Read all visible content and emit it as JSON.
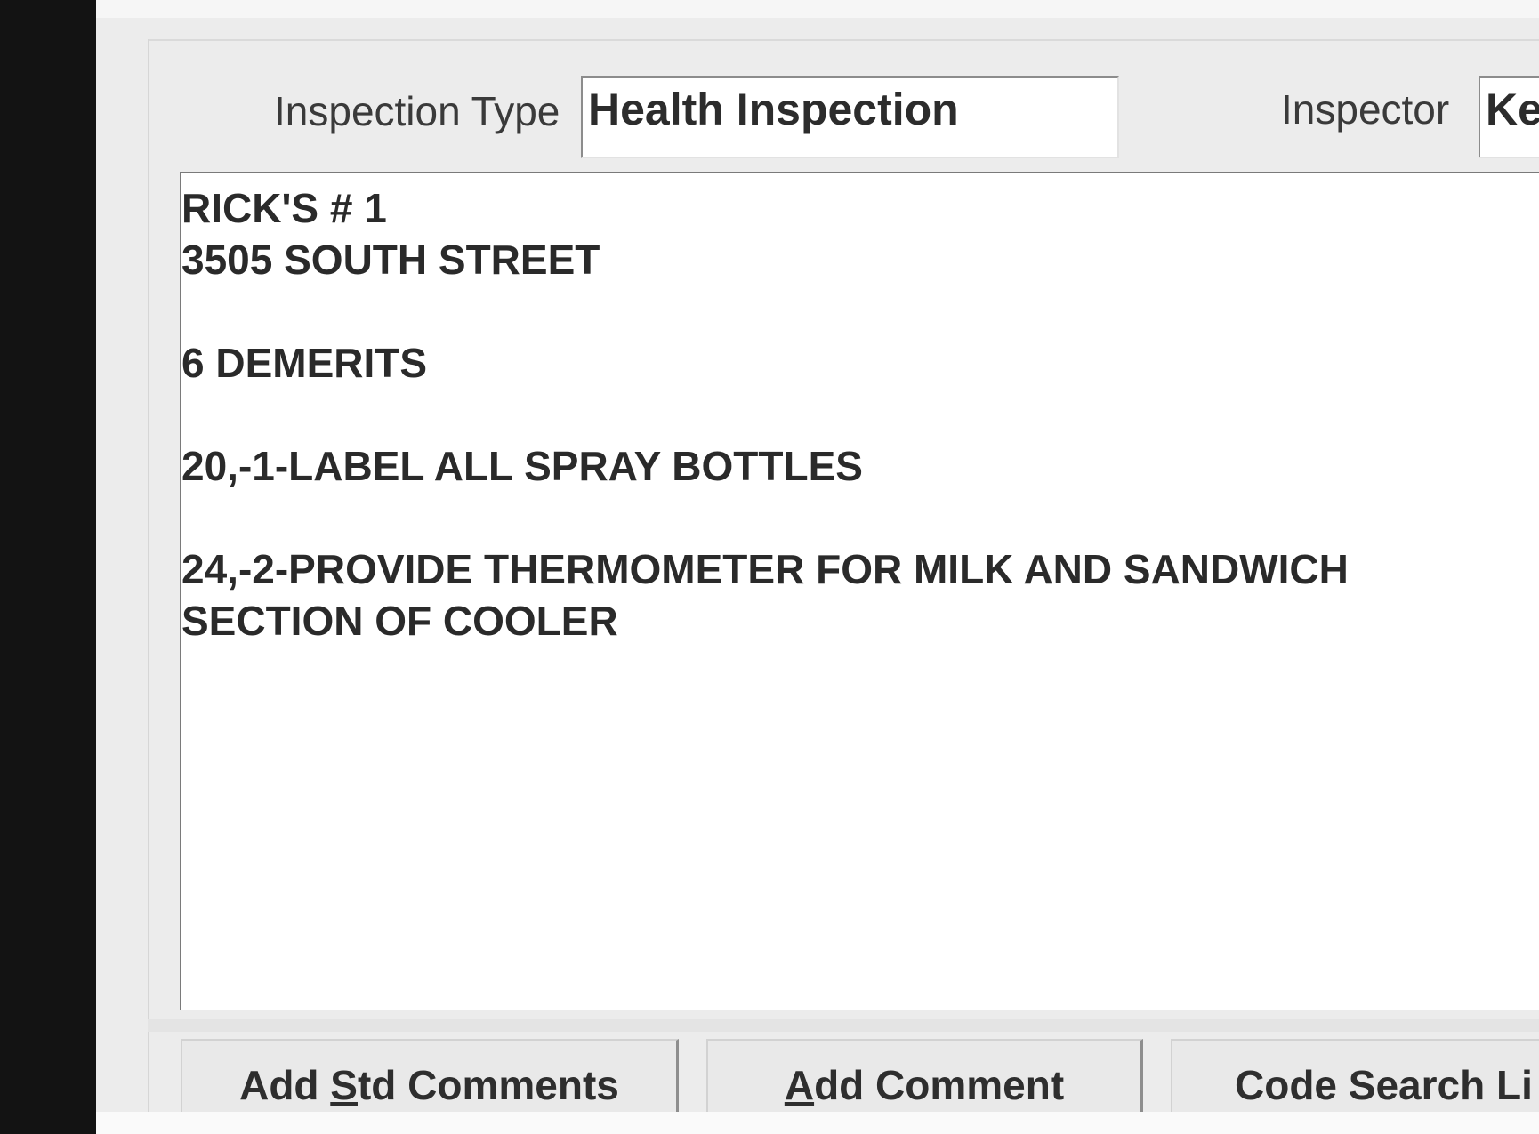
{
  "inspection": {
    "type_label": "Inspection Type",
    "type_value": "Health Inspection",
    "inspector_label": "Inspector",
    "inspector_value": "Ke"
  },
  "comments": {
    "lines": [
      "RICK'S # 1",
      "3505 SOUTH STREET",
      "",
      "6 DEMERITS",
      "",
      "20,-1-LABEL ALL SPRAY BOTTLES",
      "",
      "24,-2-PROVIDE THERMOMETER FOR MILK AND SANDWICH",
      "SECTION OF COOLER"
    ]
  },
  "buttons": {
    "add_std_comments": {
      "prefix": "Add ",
      "accel": "S",
      "suffix": "td Comments"
    },
    "add_comment": {
      "prefix": "",
      "accel": "A",
      "suffix": "dd Comment"
    },
    "code_search": {
      "prefix": "Code Search Li",
      "accel": "",
      "suffix": ""
    }
  }
}
